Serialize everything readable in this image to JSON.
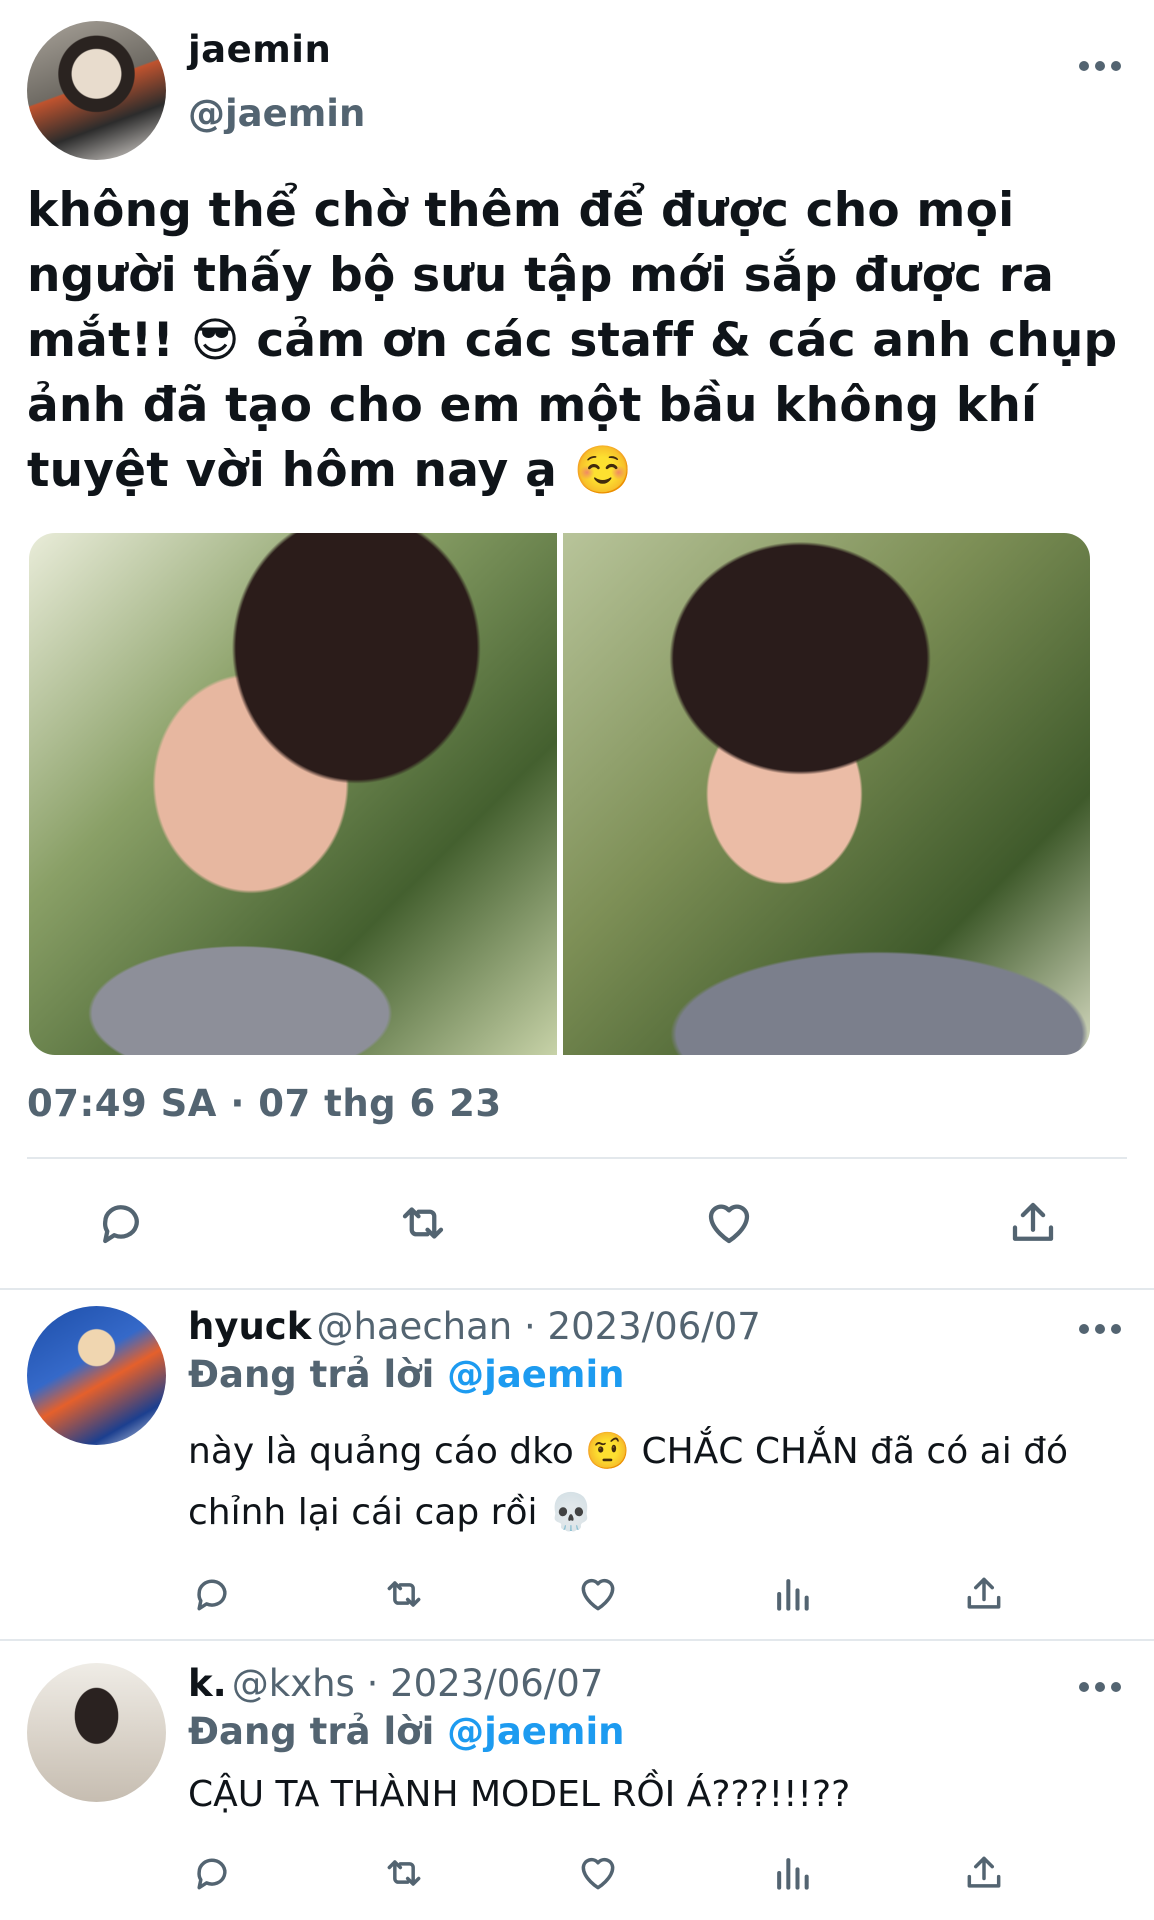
{
  "main_tweet": {
    "display_name": "jaemin",
    "handle": "@jaemin",
    "text": "không thể chờ thêm để được cho mọi người thấy bộ sưu tập mới sắp được ra mắt!! 😎 cảm ơn các staff & các anh chụp ảnh đã tạo cho em một bầu không khí tuyệt vời hôm nay ạ ☺️",
    "timestamp": "07:49 SA · 07 thg 6 23",
    "media_count": 2,
    "actions": [
      "reply-icon",
      "retweet-icon",
      "like-icon",
      "share-icon"
    ]
  },
  "replies": [
    {
      "display_name": "hyuck",
      "meta": "@haechan · 2023/06/07",
      "replying_prefix": "Đang trả lời",
      "replying_to": "@jaemin",
      "text": "này là quảng cáo dko 🤨 CHẮC CHẮN đã có ai đó chỉnh lại cái cap rồi 💀",
      "actions": [
        "reply-icon",
        "retweet-icon",
        "like-icon",
        "views-icon",
        "share-icon"
      ]
    },
    {
      "display_name": "k.",
      "meta": "@kxhs · 2023/06/07",
      "replying_prefix": "Đang trả lời",
      "replying_to": "@jaemin",
      "text": "CẬU TA THÀNH MODEL RỒI Á???!!!??",
      "actions": [
        "reply-icon",
        "retweet-icon",
        "like-icon",
        "views-icon",
        "share-icon"
      ]
    }
  ],
  "colors": {
    "text": "#0f1419",
    "secondary": "#536471",
    "accent": "#1d9bf0",
    "divider": "#e3e8ec"
  }
}
